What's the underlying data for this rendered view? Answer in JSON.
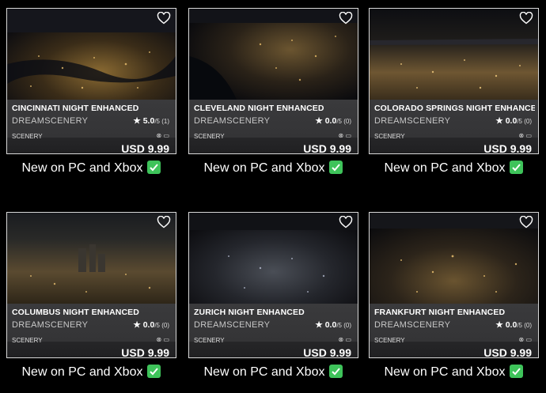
{
  "cards": [
    {
      "title": "CINCINNATI NIGHT ENHANCED",
      "publisher": "DREAMSCENERY",
      "rating": "5.0",
      "rating_suffix": "/5 (1)",
      "category": "SCENERY",
      "price": "USD 9.99",
      "caption": "New on PC and Xbox",
      "platforms": "⊗ ▭"
    },
    {
      "title": "CLEVELAND NIGHT ENHANCED",
      "publisher": "DREAMSCENERY",
      "rating": "0.0",
      "rating_suffix": "/5 (0)",
      "category": "SCENERY",
      "price": "USD 9.99",
      "caption": "New on PC and Xbox",
      "platforms": "⊗ ▭"
    },
    {
      "title": "COLORADO SPRINGS NIGHT ENHANCED",
      "publisher": "DREAMSCENERY",
      "rating": "0.0",
      "rating_suffix": "/5 (0)",
      "category": "SCENERY",
      "price": "USD 9.99",
      "caption": "New on PC and Xbox",
      "platforms": "⊗ ▭"
    },
    {
      "title": "COLUMBUS NIGHT ENHANCED",
      "publisher": "DREAMSCENERY",
      "rating": "0.0",
      "rating_suffix": "/5 (0)",
      "category": "SCENERY",
      "price": "USD 9.99",
      "caption": "New on PC and Xbox",
      "platforms": "⊗ ▭"
    },
    {
      "title": "ZURICH NIGHT ENHANCED",
      "publisher": "DREAMSCENERY",
      "rating": "0.0",
      "rating_suffix": "/5 (0)",
      "category": "SCENERY",
      "price": "USD 9.99",
      "caption": "New on PC and Xbox",
      "platforms": "⊗ ▭"
    },
    {
      "title": "FRANKFURT NIGHT ENHANCED",
      "publisher": "DREAMSCENERY",
      "rating": "0.0",
      "rating_suffix": "/5 (0)",
      "category": "SCENERY",
      "price": "USD 9.99",
      "caption": "New on PC and Xbox",
      "platforms": "⊗ ▭"
    }
  ],
  "colors": {
    "check_green": "#3ec35a",
    "card_border": "#d8d8d8",
    "info_bg": "#343436"
  },
  "icons": {
    "favorite": "heart-icon",
    "rating": "star-icon",
    "platform_xbox": "xbox-icon",
    "platform_pc": "pc-icon",
    "badge": "green-check-icon"
  }
}
